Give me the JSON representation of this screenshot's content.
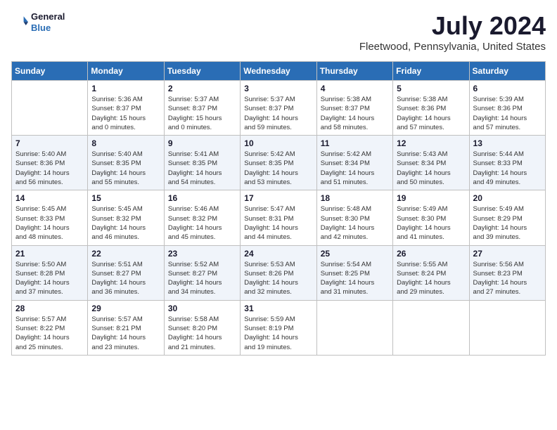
{
  "logo": {
    "line1": "General",
    "line2": "Blue"
  },
  "title": "July 2024",
  "subtitle": "Fleetwood, Pennsylvania, United States",
  "days_of_week": [
    "Sunday",
    "Monday",
    "Tuesday",
    "Wednesday",
    "Thursday",
    "Friday",
    "Saturday"
  ],
  "weeks": [
    [
      {
        "day": "",
        "info": ""
      },
      {
        "day": "1",
        "info": "Sunrise: 5:36 AM\nSunset: 8:37 PM\nDaylight: 15 hours\nand 0 minutes."
      },
      {
        "day": "2",
        "info": "Sunrise: 5:37 AM\nSunset: 8:37 PM\nDaylight: 15 hours\nand 0 minutes."
      },
      {
        "day": "3",
        "info": "Sunrise: 5:37 AM\nSunset: 8:37 PM\nDaylight: 14 hours\nand 59 minutes."
      },
      {
        "day": "4",
        "info": "Sunrise: 5:38 AM\nSunset: 8:37 PM\nDaylight: 14 hours\nand 58 minutes."
      },
      {
        "day": "5",
        "info": "Sunrise: 5:38 AM\nSunset: 8:36 PM\nDaylight: 14 hours\nand 57 minutes."
      },
      {
        "day": "6",
        "info": "Sunrise: 5:39 AM\nSunset: 8:36 PM\nDaylight: 14 hours\nand 57 minutes."
      }
    ],
    [
      {
        "day": "7",
        "info": "Sunrise: 5:40 AM\nSunset: 8:36 PM\nDaylight: 14 hours\nand 56 minutes."
      },
      {
        "day": "8",
        "info": "Sunrise: 5:40 AM\nSunset: 8:35 PM\nDaylight: 14 hours\nand 55 minutes."
      },
      {
        "day": "9",
        "info": "Sunrise: 5:41 AM\nSunset: 8:35 PM\nDaylight: 14 hours\nand 54 minutes."
      },
      {
        "day": "10",
        "info": "Sunrise: 5:42 AM\nSunset: 8:35 PM\nDaylight: 14 hours\nand 53 minutes."
      },
      {
        "day": "11",
        "info": "Sunrise: 5:42 AM\nSunset: 8:34 PM\nDaylight: 14 hours\nand 51 minutes."
      },
      {
        "day": "12",
        "info": "Sunrise: 5:43 AM\nSunset: 8:34 PM\nDaylight: 14 hours\nand 50 minutes."
      },
      {
        "day": "13",
        "info": "Sunrise: 5:44 AM\nSunset: 8:33 PM\nDaylight: 14 hours\nand 49 minutes."
      }
    ],
    [
      {
        "day": "14",
        "info": "Sunrise: 5:45 AM\nSunset: 8:33 PM\nDaylight: 14 hours\nand 48 minutes."
      },
      {
        "day": "15",
        "info": "Sunrise: 5:45 AM\nSunset: 8:32 PM\nDaylight: 14 hours\nand 46 minutes."
      },
      {
        "day": "16",
        "info": "Sunrise: 5:46 AM\nSunset: 8:32 PM\nDaylight: 14 hours\nand 45 minutes."
      },
      {
        "day": "17",
        "info": "Sunrise: 5:47 AM\nSunset: 8:31 PM\nDaylight: 14 hours\nand 44 minutes."
      },
      {
        "day": "18",
        "info": "Sunrise: 5:48 AM\nSunset: 8:30 PM\nDaylight: 14 hours\nand 42 minutes."
      },
      {
        "day": "19",
        "info": "Sunrise: 5:49 AM\nSunset: 8:30 PM\nDaylight: 14 hours\nand 41 minutes."
      },
      {
        "day": "20",
        "info": "Sunrise: 5:49 AM\nSunset: 8:29 PM\nDaylight: 14 hours\nand 39 minutes."
      }
    ],
    [
      {
        "day": "21",
        "info": "Sunrise: 5:50 AM\nSunset: 8:28 PM\nDaylight: 14 hours\nand 37 minutes."
      },
      {
        "day": "22",
        "info": "Sunrise: 5:51 AM\nSunset: 8:27 PM\nDaylight: 14 hours\nand 36 minutes."
      },
      {
        "day": "23",
        "info": "Sunrise: 5:52 AM\nSunset: 8:27 PM\nDaylight: 14 hours\nand 34 minutes."
      },
      {
        "day": "24",
        "info": "Sunrise: 5:53 AM\nSunset: 8:26 PM\nDaylight: 14 hours\nand 32 minutes."
      },
      {
        "day": "25",
        "info": "Sunrise: 5:54 AM\nSunset: 8:25 PM\nDaylight: 14 hours\nand 31 minutes."
      },
      {
        "day": "26",
        "info": "Sunrise: 5:55 AM\nSunset: 8:24 PM\nDaylight: 14 hours\nand 29 minutes."
      },
      {
        "day": "27",
        "info": "Sunrise: 5:56 AM\nSunset: 8:23 PM\nDaylight: 14 hours\nand 27 minutes."
      }
    ],
    [
      {
        "day": "28",
        "info": "Sunrise: 5:57 AM\nSunset: 8:22 PM\nDaylight: 14 hours\nand 25 minutes."
      },
      {
        "day": "29",
        "info": "Sunrise: 5:57 AM\nSunset: 8:21 PM\nDaylight: 14 hours\nand 23 minutes."
      },
      {
        "day": "30",
        "info": "Sunrise: 5:58 AM\nSunset: 8:20 PM\nDaylight: 14 hours\nand 21 minutes."
      },
      {
        "day": "31",
        "info": "Sunrise: 5:59 AM\nSunset: 8:19 PM\nDaylight: 14 hours\nand 19 minutes."
      },
      {
        "day": "",
        "info": ""
      },
      {
        "day": "",
        "info": ""
      },
      {
        "day": "",
        "info": ""
      }
    ]
  ]
}
